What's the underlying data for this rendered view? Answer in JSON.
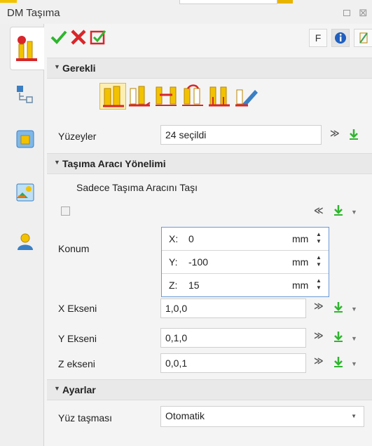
{
  "window": {
    "title": "DM Taşıma"
  },
  "toolbar": {
    "f_label": "F"
  },
  "sections": {
    "required": {
      "label": "Gerekli"
    },
    "orientation": {
      "label": "Taşıma Aracı Yönelimi"
    },
    "settings": {
      "label": "Ayarlar"
    }
  },
  "surfaces": {
    "label": "Yüzeyler",
    "value": "24 seçildi"
  },
  "move_tool_only": {
    "label": "Sadece Taşıma Aracını Taşı",
    "checked": false
  },
  "position": {
    "label": "Konum",
    "x": {
      "label": "X:",
      "value": "0",
      "unit": "mm"
    },
    "y": {
      "label": "Y:",
      "value": "-100",
      "unit": "mm"
    },
    "z": {
      "label": "Z:",
      "value": "15",
      "unit": "mm"
    }
  },
  "x_axis": {
    "label": "X Ekseni",
    "value": "1,0,0"
  },
  "y_axis": {
    "label": "Y Ekseni",
    "value": "0,1,0"
  },
  "z_axis": {
    "label": "Z ekseni",
    "value": "0,0,1"
  },
  "face_overflow": {
    "label": "Yüz taşması",
    "value": "Otomatik"
  },
  "icons": {
    "chevron_double_down": "≫",
    "chevron_double_up": "≪",
    "dropdown": "▼",
    "spin_up": "▲",
    "spin_down": "▼"
  },
  "colors": {
    "accent": "#f2c200",
    "focus_border": "#6a9ad6",
    "ok": "#2fb52f",
    "cancel": "#d8262b"
  }
}
